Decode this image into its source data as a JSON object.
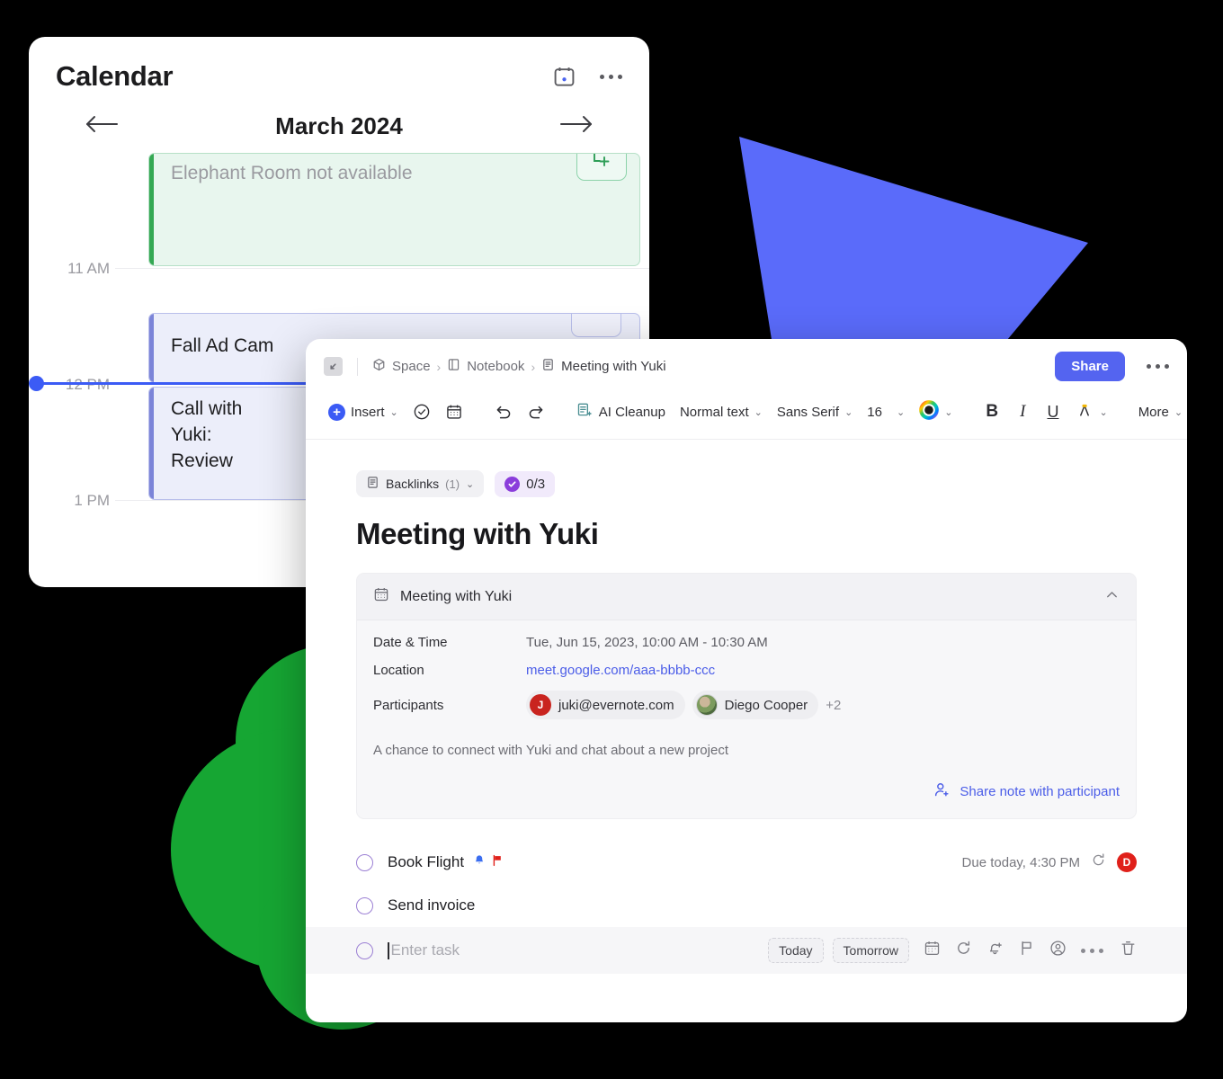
{
  "calendar_window": {
    "title": "Calendar",
    "header_icons": [
      {
        "name": "calendar-icon"
      },
      {
        "name": "more-options-icon"
      }
    ],
    "nav": {
      "prev_label": "previous-month",
      "month": "March 2024",
      "next_label": "next-month"
    },
    "hours": [
      "11 AM",
      "12 PM",
      "1 PM"
    ],
    "events": [
      {
        "title": "Elephant Room not available",
        "color": "#34a853",
        "badge_icon": "add-room-icon"
      },
      {
        "title": "Fall Ad Cam",
        "color": "#7b84d8"
      },
      {
        "title": "Call with Yuki: Review",
        "color": "#7b84d8"
      }
    ],
    "now_indicator_color": "#3b5bf5"
  },
  "note_window": {
    "topbar": {
      "expand_icon": "expand-icon",
      "breadcrumbs": [
        {
          "label": "Space",
          "icon": "space-cube-icon"
        },
        {
          "label": "Notebook",
          "icon": "notebook-icon"
        },
        {
          "label": "Meeting with Yuki",
          "icon": "note-icon"
        }
      ],
      "separator": "›",
      "share_label": "Share",
      "share_color": "#5464f0",
      "more_icon": "more-options-icon"
    },
    "toolbar": {
      "insert_label": "Insert",
      "task_icon": "check-circle-icon",
      "calendar_icon": "calendar-icon",
      "undo_icon": "undo-icon",
      "redo_icon": "redo-icon",
      "ai_cleanup_label": "AI Cleanup",
      "ai_cleanup_icon": "ai-cleanup-icon",
      "paragraph_style": "Normal text",
      "font_family": "Sans Serif",
      "font_size": "16",
      "text_color_icon": "text-color-wheel-icon",
      "bold_label": "B",
      "italic_label": "I",
      "underline_label": "U",
      "highlight_icon": "highlight-pen-icon",
      "more_label": "More"
    },
    "chips": {
      "backlinks_label": "Backlinks",
      "backlinks_count": "(1)",
      "tasks_progress": "0/3"
    },
    "note_title": "Meeting with Yuki",
    "meeting_card": {
      "header_title": "Meeting with Yuki",
      "header_icon": "calendar-icon",
      "collapse_icon": "chevron-up-icon",
      "rows": [
        {
          "label": "Date & Time",
          "value": "Tue, Jun 15, 2023, 10:00 AM - 10:30 AM",
          "type": "text"
        },
        {
          "label": "Location",
          "value": "meet.google.com/aaa-bbbb-ccc",
          "type": "link"
        },
        {
          "label": "Participants",
          "type": "participants"
        }
      ],
      "participants": [
        {
          "name": "juki@evernote.com",
          "avatar_letter": "J",
          "avatar_color": "#c9241f"
        },
        {
          "name": "Diego Cooper",
          "avatar_letter": "",
          "avatar_color": "photo"
        }
      ],
      "participants_overflow": "+2",
      "description": "A chance to connect with Yuki and chat about a new project",
      "share_note_label": "Share note with participant",
      "share_note_icon": "add-person-icon"
    },
    "tasks": [
      {
        "label": "Book Flight",
        "icons": [
          "bell-icon",
          "flag-icon"
        ],
        "due": "Due today, 4:30 PM",
        "repeat_icon": "repeat-icon",
        "assignee_letter": "D",
        "assignee_color": "#e0201a"
      },
      {
        "label": "Send invoice",
        "icons": [],
        "due": "",
        "assignee_letter": ""
      }
    ],
    "new_task": {
      "placeholder": "Enter task",
      "today_label": "Today",
      "tomorrow_label": "Tomorrow",
      "icons": [
        "calendar-icon",
        "repeat-icon",
        "reminder-bell-icon",
        "flag-icon",
        "assignee-icon",
        "more-options-icon",
        "trash-icon"
      ]
    }
  },
  "background": {
    "canvas_color": "#000000",
    "blue_shape_color": "#5a6bfa",
    "green_shape_color": "#16a633"
  }
}
